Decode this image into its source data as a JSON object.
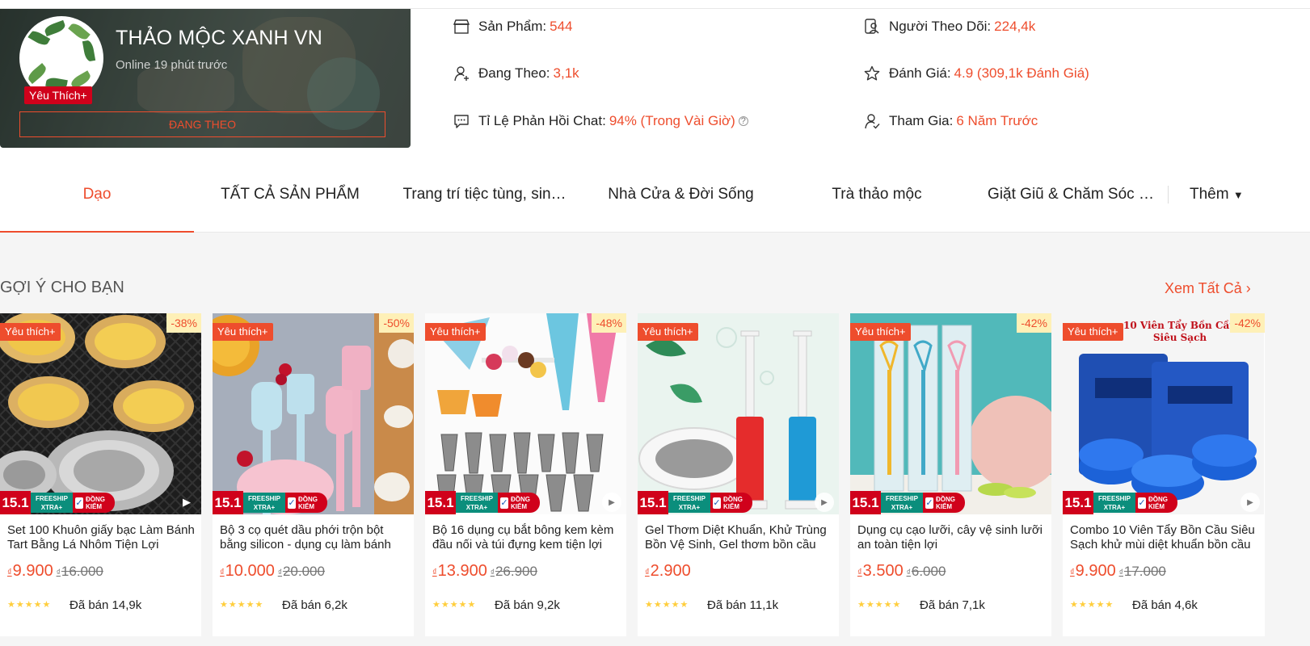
{
  "shop": {
    "name": "THẢO MỘC XANH VN",
    "online_status": "Online 19 phút trước",
    "fav_badge": "Yêu Thích+",
    "follow_button": "ĐANG THEO",
    "stats": [
      {
        "icon": "store-icon",
        "label": "Sản Phẩm:",
        "value": "544"
      },
      {
        "icon": "follower-icon",
        "label": "Người Theo Dõi:",
        "value": "224,4k"
      },
      {
        "icon": "user-plus-icon",
        "label": "Đang Theo:",
        "value": "3,1k"
      },
      {
        "icon": "star-icon",
        "label": "Đánh Giá:",
        "value": "4.9 (309,1k Đánh Giá)"
      },
      {
        "icon": "chat-icon",
        "label": "Tỉ Lệ Phản Hồi Chat:",
        "value": "94% (Trong Vài Giờ)"
      },
      {
        "icon": "user-check-icon",
        "label": "Tham Gia:",
        "value": "6 Năm Trước"
      }
    ],
    "help_glyph": "?"
  },
  "tabs": {
    "items": [
      "Dạo",
      "TẤT CẢ SẢN PHẨM",
      "Trang trí tiệc tùng, sin…",
      "Nhà Cửa & Đời Sống",
      "Trà thảo mộc",
      "Giặt Giũ & Chăm Sóc …"
    ],
    "active_index": 0,
    "more_label": "Thêm",
    "more_icon": "caret-down-icon"
  },
  "section": {
    "title": "GỢI Ý CHO BẠN",
    "see_all": "Xem Tất Cả",
    "see_all_icon": "chevron-right-icon"
  },
  "promo": {
    "event": "15.1",
    "freeship": "FREESHIP",
    "xtra": "XTRA+",
    "dong_kiem": "ĐỒNG KIỂM"
  },
  "currency": "₫",
  "products": [
    {
      "fav": "Yêu thích+",
      "discount": "-38%",
      "title": "Set 100 Khuôn giấy bạc Làm Bánh Tart Bằng Lá Nhôm Tiện Lợi",
      "price": "9.900",
      "old_price": "16.000",
      "sold": "Đã bán 14,9k",
      "image": "tart-molds"
    },
    {
      "fav": "Yêu thích+",
      "discount": "-50%",
      "title": "Bộ 3 cọ quét dầu phới trộn bột bằng silicon - dụng cụ làm bánh",
      "price": "10.000",
      "old_price": "20.000",
      "sold": "Đã bán 6,2k",
      "image": "silicone-brushes"
    },
    {
      "fav": "Yêu thích+",
      "discount": "-48%",
      "title": "Bộ 16 dụng cụ bắt bông kem kèm đầu nối và túi đựng kem tiện lợi",
      "price": "13.900",
      "old_price": "26.900",
      "sold": "Đã bán 9,2k",
      "image": "piping-tips"
    },
    {
      "fav": "Yêu thích+",
      "discount": "",
      "title": "Gel Thơm Diệt Khuẩn, Khử Trùng Bồn Vệ Sinh, Gel thơm bồn cầu",
      "price": "2.900",
      "old_price": "",
      "sold": "Đã bán 11,1k",
      "image": "toilet-gel"
    },
    {
      "fav": "Yêu thích+",
      "discount": "-42%",
      "title": "Dụng cụ cạo lưỡi, cây vệ sinh lưỡi an toàn tiện lợi",
      "price": "3.500",
      "old_price": "6.000",
      "sold": "Đã bán 7,1k",
      "image": "tongue-scraper"
    },
    {
      "fav": "Yêu thích+",
      "discount": "-42%",
      "title": "Combo 10 Viên Tẩy Bồn Cầu Siêu Sạch khử mùi diệt khuẩn bồn cầu",
      "price": "9.900",
      "old_price": "17.000",
      "sold": "Đã bán 4,6k",
      "image": "toilet-tablets"
    }
  ],
  "product_6_overlay": "10 Viên Tẩy Bồn Cầu Siêu Sạch",
  "stars": "★★★★★"
}
